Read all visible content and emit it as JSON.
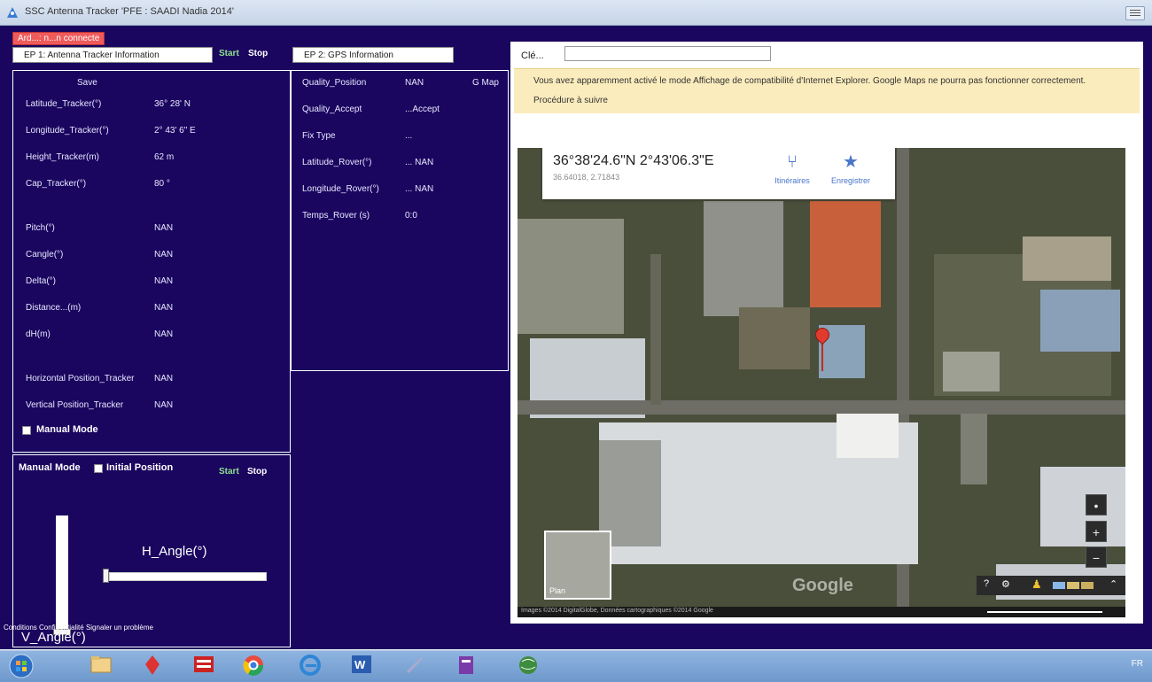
{
  "window": {
    "title": "SSC Antenna Tracker 'PFE : SAADI Nadia 2014'"
  },
  "status": {
    "label": "Ard...: n...n connecte"
  },
  "tabs": {
    "ep1": "EP 1: Antenna Tracker Information",
    "ep2": "EP 2: GPS Information",
    "start": "Start",
    "stop": "Stop"
  },
  "ep1": {
    "save_label": "Save",
    "fields": [
      {
        "label": "Latitude_Tracker(°)",
        "value": "36° 28' N"
      },
      {
        "label": "Longitude_Tracker(°)",
        "value": "2° 43' 6\" E"
      },
      {
        "label": "Height_Tracker(m)",
        "value": "62 m"
      },
      {
        "label": "Cap_Tracker(°)",
        "value": "80 °"
      },
      {
        "label": "Pitch(°)",
        "value": "NAN"
      },
      {
        "label": "Cangle(°)",
        "value": "NAN"
      },
      {
        "label": "Delta(°)",
        "value": "NAN"
      },
      {
        "label": "Distance...(m)",
        "value": "NAN"
      },
      {
        "label": "dH(m)",
        "value": "NAN"
      },
      {
        "label": "Horizontal Position_Tracker",
        "value": "NAN"
      },
      {
        "label": "Vertical Position_Tracker",
        "value": "NAN"
      }
    ],
    "manual_mode_label": "Manual Mode"
  },
  "ep2": {
    "gmap_label": "G Map",
    "fields": [
      {
        "label": "Quality_Position",
        "value": "NAN"
      },
      {
        "label": "Quality_Accept",
        "value": "...Accept"
      },
      {
        "label": "Fix Type",
        "value": "..."
      },
      {
        "label": "Latitude_Rover(°)",
        "value": "... NAN"
      },
      {
        "label": "Longitude_Rover(°)",
        "value": "... NAN"
      },
      {
        "label": "Temps_Rover (s)",
        "value": "0:0"
      }
    ]
  },
  "manual": {
    "mode_label": "Manual Mode",
    "initial_position": "Initial Position",
    "start": "Start",
    "stop": "Stop",
    "h_angle": "H_Angle(°)",
    "v_angle": "V_Angle(°)",
    "h_angle_level": 0,
    "v_angle_level": 0
  },
  "browser": {
    "cleu_label": "Clé...",
    "cleu_value": "",
    "notice_line1": "Vous avez apparemment activé le mode Affichage de compatibilité d'Internet Explorer. Google Maps ne pourra pas fonctionner correctement.",
    "notice_line2": "Procédure à suivre"
  },
  "map": {
    "coordinates": "36°38'24.6\"N 2°43'06.3\"E",
    "address": "36.64018, 2.71843",
    "itinerary": "Itinéraires",
    "save": "Enregistrer",
    "minimap_label": "Plan",
    "watermark": "Google",
    "attribution": "Images ©2014 DigitalGlobe, Données cartographiques ©2014 Google",
    "links": "Conditions   Confidentialité   Signaler un problème",
    "zoom_in": "+",
    "zoom_out": "−"
  },
  "taskbar": {
    "tray": "FR"
  }
}
